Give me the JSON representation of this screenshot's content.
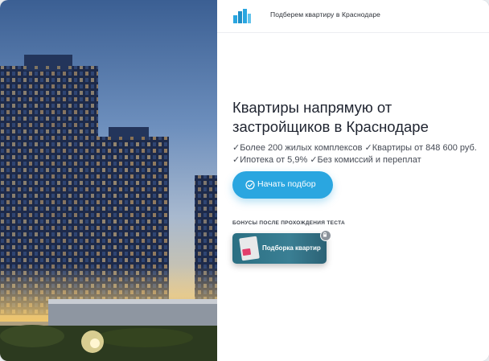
{
  "header": {
    "logo": "building-logo-icon",
    "title": "Подберем квартиру в Краснодаре"
  },
  "hero": {
    "title_line1": "Квартиры напрямую от",
    "title_line2": "застройщиков в Краснодаре",
    "features_line1": "✓Более 200 жилых комплексов ✓Квартиры от 848 600 руб.",
    "features_line2": "✓Ипотека от 5,9% ✓Без комиссий и переплат"
  },
  "cta": {
    "icon": "check-circle-icon",
    "label": "Начать подбор",
    "color": "#2aa6e0"
  },
  "bonus": {
    "title": "БОНУСЫ ПОСЛЕ ПРОХОЖДЕНИЯ ТЕСТА",
    "card_label": "Подборка квартир",
    "badge_icon": "lock-icon"
  },
  "photo": {
    "subject": "residential-towers-photo"
  }
}
